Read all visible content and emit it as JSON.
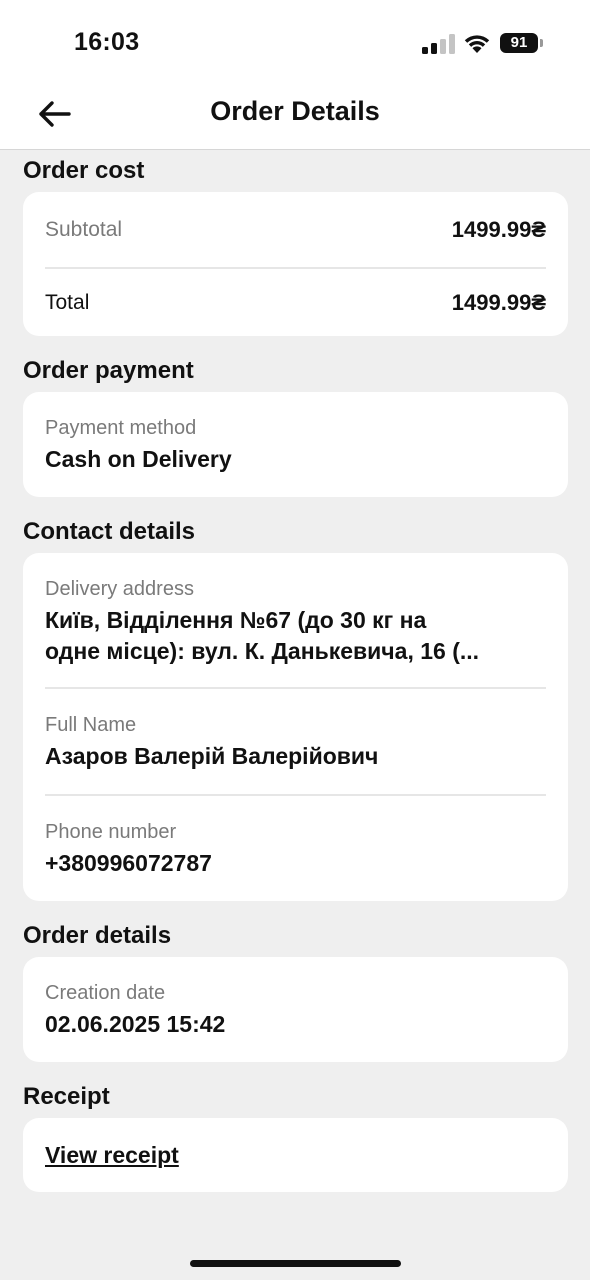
{
  "status_bar": {
    "time": "16:03",
    "battery": "91"
  },
  "header": {
    "title": "Order Details"
  },
  "order_cost": {
    "title": "Order cost",
    "subtotal_label": "Subtotal",
    "subtotal_value": "1499.99₴",
    "total_label": "Total",
    "total_value": "1499.99₴"
  },
  "order_payment": {
    "title": "Order payment",
    "method_label": "Payment method",
    "method_value": "Cash on Delivery"
  },
  "contact_details": {
    "title": "Contact details",
    "address_label": "Delivery address",
    "address_line1": "Київ, Відділення №67 (до 30 кг на",
    "address_line2": "одне місце): вул. К. Данькевича, 16 (...",
    "name_label": "Full Name",
    "name_value": "Азаров Валерій Валерійович",
    "phone_label": "Phone number",
    "phone_value": "+380996072787"
  },
  "order_details": {
    "title": "Order details",
    "creation_label": "Creation date",
    "creation_value": "02.06.2025 15:42"
  },
  "receipt": {
    "title": "Receipt",
    "link_label": "View receipt"
  }
}
